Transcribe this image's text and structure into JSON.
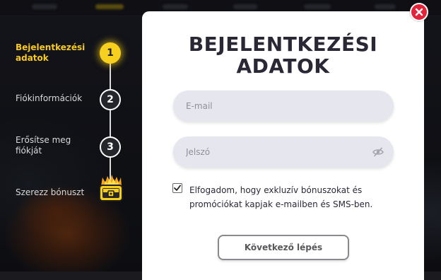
{
  "modal": {
    "title_line1": "BEJELENTKEZÉSI",
    "title_line2": "ADATOK",
    "close_icon": "close-icon"
  },
  "steps": [
    {
      "label_line1": "Bejelentkezési",
      "label_line2": "adatok",
      "number": "1",
      "active": true
    },
    {
      "label_line1": "Fiókinformációk",
      "label_line2": "",
      "number": "2",
      "active": false
    },
    {
      "label_line1": "Erősítse meg",
      "label_line2": "fiókját",
      "number": "3",
      "active": false
    },
    {
      "label_line1": "Szerezz bónuszt",
      "label_line2": "",
      "icon": "treasure-chest-icon",
      "active": false
    }
  ],
  "form": {
    "email_placeholder": "E-mail",
    "email_value": "",
    "password_placeholder": "Jelszó",
    "password_value": "",
    "password_toggle_icon": "eye-slash-icon",
    "consent_checked": true,
    "consent_line1": "Elfogadom, hogy exkluzív bónuszokat és",
    "consent_line2": "promóciókat kapjak e-mailben és SMS-ben.",
    "next_label": "Következő lépés"
  },
  "colors": {
    "accent_yellow": "#f7cf1e",
    "close_red": "#e2233a",
    "title_dark": "#2b2836",
    "field_bg": "#e5e6ee"
  }
}
